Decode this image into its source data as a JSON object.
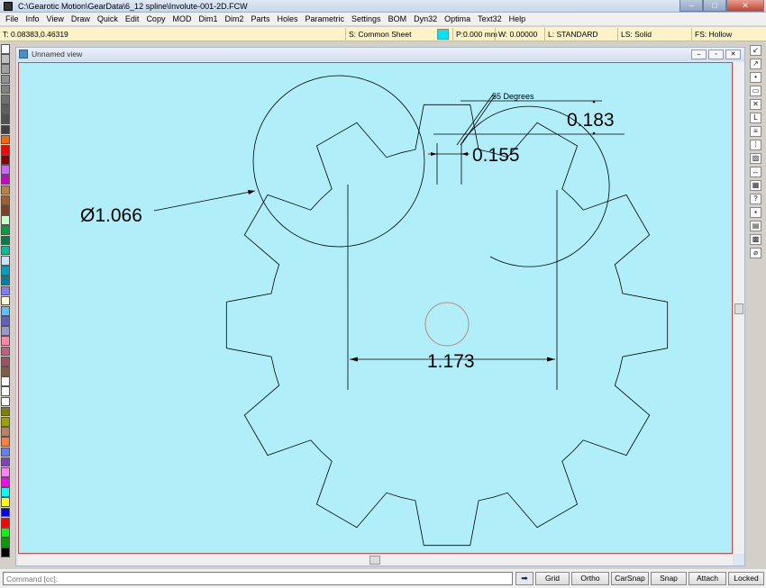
{
  "window": {
    "title": "C:\\Gearotic Motion\\GearData\\6_12 spline\\Involute-001-2D.FCW",
    "minimize": "–",
    "maximize": "□",
    "close": "✕"
  },
  "menu": [
    "File",
    "Info",
    "View",
    "Draw",
    "Quick",
    "Edit",
    "Copy",
    "MOD",
    "Dim1",
    "Dim2",
    "Parts",
    "Holes",
    "Parametric",
    "Settings",
    "BOM",
    "Dyn32",
    "Optima",
    "Text32",
    "Help"
  ],
  "status": {
    "coords": "T: 0.08383,0.46319",
    "sheet": "S: Common Sheet",
    "pen": "P:0.000 mm",
    "width": "W: 0.00000",
    "layer": "L: STANDARD",
    "line_style": "LS: Solid",
    "fill_style": "FS: Hollow",
    "color": "#00e5f5"
  },
  "view": {
    "title": "Unnamed view",
    "background": "#b0eefa"
  },
  "palette": [
    "#ffffff",
    "#c0c0c0",
    "#a0a0a0",
    "#909090",
    "#808080",
    "#707070",
    "#606060",
    "#505050",
    "#404040",
    "#ff6600",
    "#ff0000",
    "#880000",
    "#cc66ff",
    "#cc00cc",
    "#c08040",
    "#a06030",
    "#804020",
    "#c8ffc8",
    "#00a040",
    "#008040",
    "#00c0a0",
    "#c0e8ff",
    "#00a0c0",
    "#0080a0",
    "#8080ff",
    "#ffffcc",
    "#60c0ff",
    "#6060c0",
    "#9999cc",
    "#ff88aa",
    "#c06080",
    "#a05060",
    "#806040",
    "#ffffff",
    "#ffffff",
    "#ffffff",
    "#808000",
    "#a0a000",
    "#c08060",
    "#ff8040",
    "#6080ff",
    "#8040c0",
    "#ff80ff",
    "#ff00ff",
    "#00ffff",
    "#ffff00",
    "#0000ff",
    "#ff0000",
    "#00ff00",
    "#00a000",
    "#000000"
  ],
  "toolbar_icons": [
    "arrow-in-icon",
    "arrow-out-icon",
    "point-icon",
    "rectangle-icon",
    "cross-icon",
    "corner-icon",
    "lines-icon",
    "grid-dots-icon",
    "hatch-icon",
    "dimension-icon",
    "table-icon",
    "help-icon",
    "record-icon",
    "layers-icon",
    "palette-icon",
    "measure-icon"
  ],
  "drawing": {
    "dim_diameter": "Ø1.066",
    "dim_center": "1.173",
    "dim_width": "0.155",
    "dim_height": "0.183",
    "dim_angle": "55 Degrees"
  },
  "command": {
    "placeholder": "Command [cc]:",
    "arrow": "➡"
  },
  "buttons": {
    "grid": "Grid",
    "ortho": "Ortho",
    "carsnap": "CarSnap",
    "snap": "Snap",
    "attach": "Attach",
    "locked": "Locked"
  }
}
